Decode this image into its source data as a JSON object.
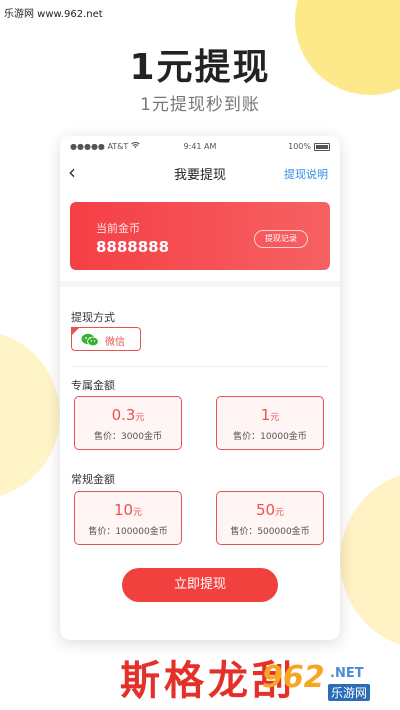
{
  "watermark": "乐游网 www.962.net",
  "headline": "1元提现",
  "subline": "1元提现秒到账",
  "status": {
    "carrier": "●●●●● AT&T",
    "time": "9:41 AM",
    "battery": "100%"
  },
  "nav": {
    "back": "‹",
    "title": "我要提现",
    "link": "提现说明"
  },
  "card": {
    "label": "当前金币",
    "value": "8888888",
    "record_button": "提现记录"
  },
  "method": {
    "section": "提现方式",
    "option": "微信"
  },
  "exclusive": {
    "section": "专属金额",
    "options": [
      {
        "amount": "0.3",
        "unit": "元",
        "price": "售价：3000金币"
      },
      {
        "amount": "1",
        "unit": "元",
        "price": "售价：10000金币"
      }
    ]
  },
  "regular": {
    "section": "常规金额",
    "options": [
      {
        "amount": "10",
        "unit": "元",
        "price": "售价：100000金币"
      },
      {
        "amount": "50",
        "unit": "元",
        "price": "售价：500000金币"
      }
    ]
  },
  "submit": "立即提现",
  "bottom_text": "斯格龙刮",
  "logo": {
    "number": "962",
    "net": ".NET",
    "cn": "乐游网"
  },
  "colors": {
    "accent": "#f0413e",
    "link": "#2f8de4",
    "wechat": "#3cb034"
  }
}
